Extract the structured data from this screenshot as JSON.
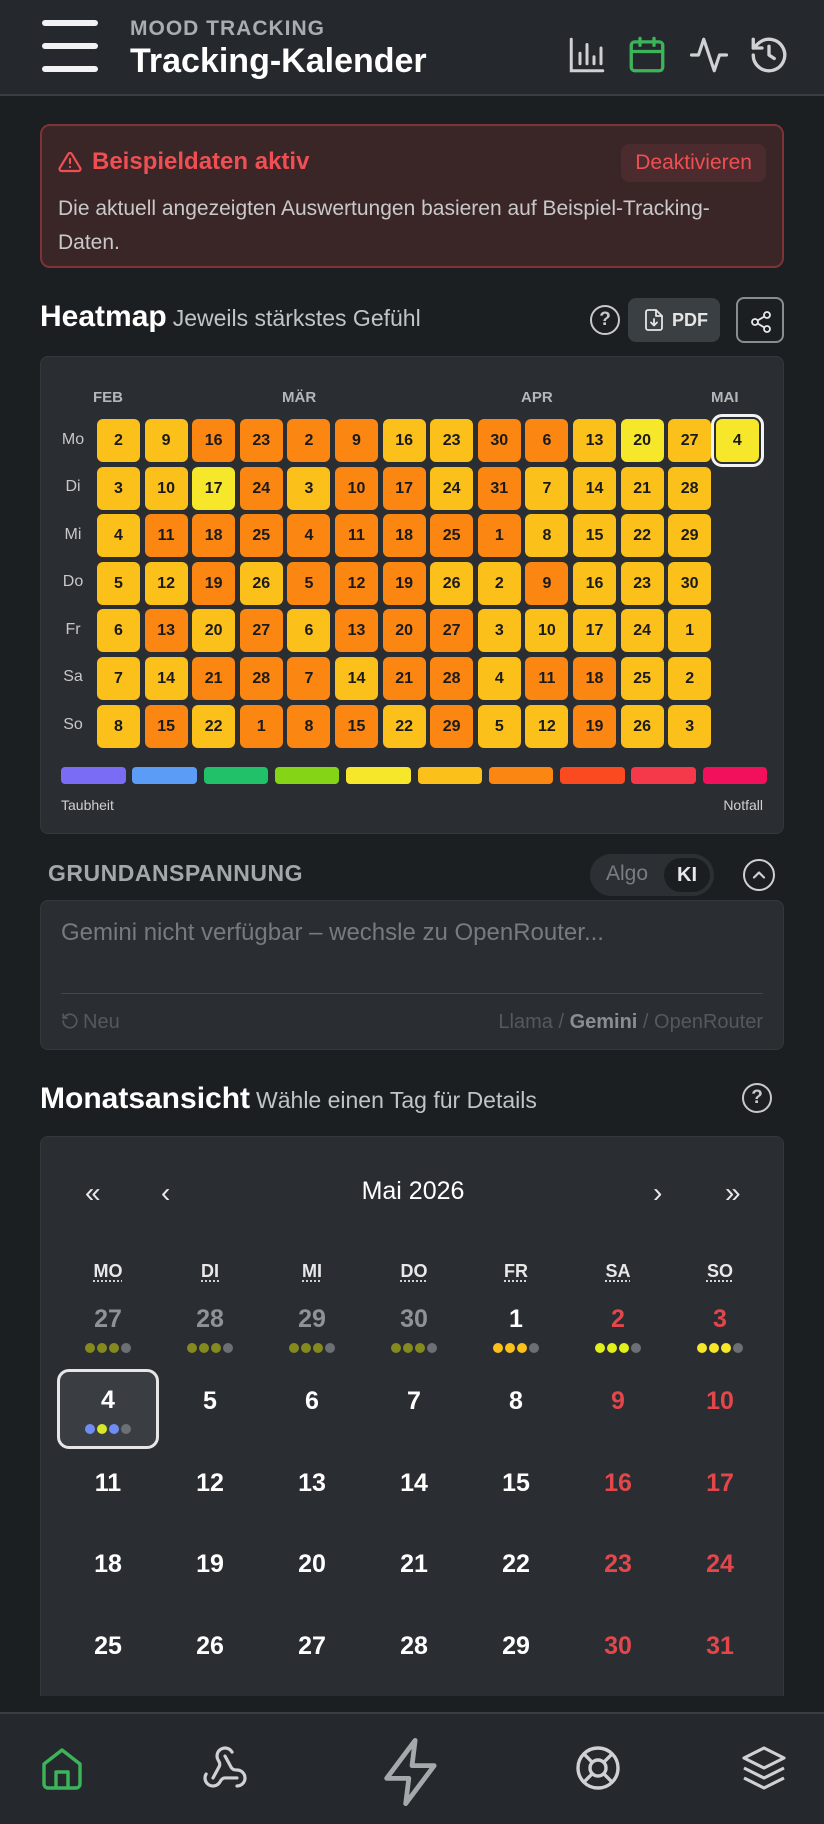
{
  "header": {
    "subtitle": "MOOD TRACKING",
    "title": "Tracking-Kalender",
    "icons": [
      "menu-icon",
      "bar-chart-icon",
      "calendar-icon",
      "activity-icon",
      "history-icon"
    ],
    "active_color": "#3cb55a"
  },
  "banner": {
    "title": "Beispieldaten aktiv",
    "button": "Deaktivieren",
    "text": "Die aktuell angezeigten Auswertungen basieren auf Beispiel-Tracking-Daten."
  },
  "heatmap": {
    "title": "Heatmap",
    "subtitle": "Jeweils stärkstes Gefühl",
    "help": "?",
    "pdf_label": "PDF",
    "months": [
      "FEB",
      "MÄR",
      "APR",
      "MAI"
    ],
    "days": [
      "Mo",
      "Di",
      "Mi",
      "Do",
      "Fr",
      "Sa",
      "So"
    ],
    "legend_left": "Taubheit",
    "legend_right": "Notfall",
    "legend_colors": [
      "#7b6cf6",
      "#5b9cf7",
      "#21c16a",
      "#86d416",
      "#f7e72a",
      "#fbc01a",
      "#fb8611",
      "#fb4a1f",
      "#f5384a",
      "#f20f5c"
    ],
    "columns": [
      [
        {
          "d": "2",
          "c": "#fbc01a"
        },
        {
          "d": "3",
          "c": "#fbc01a"
        },
        {
          "d": "4",
          "c": "#fbc01a"
        },
        {
          "d": "5",
          "c": "#fbc01a"
        },
        {
          "d": "6",
          "c": "#fbc01a"
        },
        {
          "d": "7",
          "c": "#fbc01a"
        },
        {
          "d": "8",
          "c": "#fbc01a"
        }
      ],
      [
        {
          "d": "9",
          "c": "#fbc01a"
        },
        {
          "d": "10",
          "c": "#fbc01a"
        },
        {
          "d": "11",
          "c": "#fb8611"
        },
        {
          "d": "12",
          "c": "#fbc01a"
        },
        {
          "d": "13",
          "c": "#fb8611"
        },
        {
          "d": "14",
          "c": "#fbc01a"
        },
        {
          "d": "15",
          "c": "#fb8611"
        }
      ],
      [
        {
          "d": "16",
          "c": "#fb8611"
        },
        {
          "d": "17",
          "c": "#f7e72a"
        },
        {
          "d": "18",
          "c": "#fb8611"
        },
        {
          "d": "19",
          "c": "#fb8611"
        },
        {
          "d": "20",
          "c": "#fbc01a"
        },
        {
          "d": "21",
          "c": "#fb8611"
        },
        {
          "d": "22",
          "c": "#fbc01a"
        }
      ],
      [
        {
          "d": "23",
          "c": "#fb8611"
        },
        {
          "d": "24",
          "c": "#fb8611"
        },
        {
          "d": "25",
          "c": "#fb8611"
        },
        {
          "d": "26",
          "c": "#fbc01a"
        },
        {
          "d": "27",
          "c": "#fb8611"
        },
        {
          "d": "28",
          "c": "#fb8611"
        },
        {
          "d": "1",
          "c": "#fb8611"
        }
      ],
      [
        {
          "d": "2",
          "c": "#fb8611"
        },
        {
          "d": "3",
          "c": "#fbc01a"
        },
        {
          "d": "4",
          "c": "#fb8611"
        },
        {
          "d": "5",
          "c": "#fb8611"
        },
        {
          "d": "6",
          "c": "#fbc01a"
        },
        {
          "d": "7",
          "c": "#fb8611"
        },
        {
          "d": "8",
          "c": "#fb8611"
        }
      ],
      [
        {
          "d": "9",
          "c": "#fb8611"
        },
        {
          "d": "10",
          "c": "#fb8611"
        },
        {
          "d": "11",
          "c": "#fb8611"
        },
        {
          "d": "12",
          "c": "#fb8611"
        },
        {
          "d": "13",
          "c": "#fb8611"
        },
        {
          "d": "14",
          "c": "#fbc01a"
        },
        {
          "d": "15",
          "c": "#fb8611"
        }
      ],
      [
        {
          "d": "16",
          "c": "#fbc01a"
        },
        {
          "d": "17",
          "c": "#fb8611"
        },
        {
          "d": "18",
          "c": "#fb8611"
        },
        {
          "d": "19",
          "c": "#fb8611"
        },
        {
          "d": "20",
          "c": "#fb8611"
        },
        {
          "d": "21",
          "c": "#fb8611"
        },
        {
          "d": "22",
          "c": "#fbc01a"
        }
      ],
      [
        {
          "d": "23",
          "c": "#fbc01a"
        },
        {
          "d": "24",
          "c": "#fbc01a"
        },
        {
          "d": "25",
          "c": "#fb8611"
        },
        {
          "d": "26",
          "c": "#fbc01a"
        },
        {
          "d": "27",
          "c": "#fb8611"
        },
        {
          "d": "28",
          "c": "#fb8611"
        },
        {
          "d": "29",
          "c": "#fb8611"
        }
      ],
      [
        {
          "d": "30",
          "c": "#fb8611"
        },
        {
          "d": "31",
          "c": "#fb8611"
        },
        {
          "d": "1",
          "c": "#fb8611"
        },
        {
          "d": "2",
          "c": "#fbc01a"
        },
        {
          "d": "3",
          "c": "#fbc01a"
        },
        {
          "d": "4",
          "c": "#fbc01a"
        },
        {
          "d": "5",
          "c": "#fbc01a"
        }
      ],
      [
        {
          "d": "6",
          "c": "#fb8611"
        },
        {
          "d": "7",
          "c": "#fbc01a"
        },
        {
          "d": "8",
          "c": "#fbc01a"
        },
        {
          "d": "9",
          "c": "#fb8611"
        },
        {
          "d": "10",
          "c": "#fbc01a"
        },
        {
          "d": "11",
          "c": "#fb8611"
        },
        {
          "d": "12",
          "c": "#fbc01a"
        }
      ],
      [
        {
          "d": "13",
          "c": "#fbc01a"
        },
        {
          "d": "14",
          "c": "#fbc01a"
        },
        {
          "d": "15",
          "c": "#fbc01a"
        },
        {
          "d": "16",
          "c": "#fbc01a"
        },
        {
          "d": "17",
          "c": "#fbc01a"
        },
        {
          "d": "18",
          "c": "#fb8611"
        },
        {
          "d": "19",
          "c": "#fb8611"
        }
      ],
      [
        {
          "d": "20",
          "c": "#f7e72a"
        },
        {
          "d": "21",
          "c": "#fbc01a"
        },
        {
          "d": "22",
          "c": "#fbc01a"
        },
        {
          "d": "23",
          "c": "#fbc01a"
        },
        {
          "d": "24",
          "c": "#fbc01a"
        },
        {
          "d": "25",
          "c": "#fbc01a"
        },
        {
          "d": "26",
          "c": "#fbc01a"
        }
      ],
      [
        {
          "d": "27",
          "c": "#fbc01a"
        },
        {
          "d": "28",
          "c": "#fbc01a"
        },
        {
          "d": "29",
          "c": "#fbc01a"
        },
        {
          "d": "30",
          "c": "#fbc01a"
        },
        {
          "d": "1",
          "c": "#fbc01a"
        },
        {
          "d": "2",
          "c": "#fbc01a"
        },
        {
          "d": "3",
          "c": "#fbc01a"
        }
      ],
      [
        {
          "d": "4",
          "c": "#f7e72a",
          "selected": true
        }
      ]
    ]
  },
  "grundanspannung": {
    "title": "GRUNDANSPANNUNG",
    "toggle_algo": "Algo",
    "toggle_ki": "KI",
    "text": "Gemini nicht verfügbar – wechsle zu OpenRouter...",
    "new_label": "Neu",
    "sources": [
      "Llama",
      "Gemini",
      "OpenRouter"
    ],
    "active_source": "Gemini"
  },
  "month_view": {
    "title": "Monatsansicht",
    "subtitle": "Wähle einen Tag für Details",
    "month_label": "Mai 2026",
    "nav": {
      "first": "«",
      "prev": "‹",
      "next": "›",
      "last": "»"
    },
    "weekdays": [
      "MO",
      "DI",
      "MI",
      "DO",
      "FR",
      "SA",
      "SO"
    ],
    "weeks": [
      [
        {
          "d": "27",
          "other": true,
          "dots": [
            "#858a1f",
            "#858a1f",
            "#858a1f",
            "#6c6f73"
          ]
        },
        {
          "d": "28",
          "other": true,
          "dots": [
            "#858a1f",
            "#858a1f",
            "#858a1f",
            "#6c6f73"
          ]
        },
        {
          "d": "29",
          "other": true,
          "dots": [
            "#858a1f",
            "#858a1f",
            "#858a1f",
            "#6c6f73"
          ]
        },
        {
          "d": "30",
          "other": true,
          "dots": [
            "#858a1f",
            "#858a1f",
            "#858a1f",
            "#6c6f73"
          ]
        },
        {
          "d": "1",
          "dots": [
            "#fbc01a",
            "#fbc01a",
            "#fbc01a",
            "#6c6f73"
          ]
        },
        {
          "d": "2",
          "we": true,
          "dots": [
            "#e0f01a",
            "#e0f01a",
            "#e0f01a",
            "#6c6f73"
          ]
        },
        {
          "d": "3",
          "we": true,
          "dots": [
            "#f7e72a",
            "#f7e72a",
            "#f7e72a",
            "#6c6f73"
          ]
        }
      ],
      [
        {
          "d": "4",
          "today": true,
          "dots": [
            "#6f8df5",
            "#d7e82a",
            "#6f8df5",
            "#6c6f73"
          ]
        },
        {
          "d": "5"
        },
        {
          "d": "6"
        },
        {
          "d": "7"
        },
        {
          "d": "8"
        },
        {
          "d": "9",
          "we": true
        },
        {
          "d": "10",
          "we": true
        }
      ],
      [
        {
          "d": "11"
        },
        {
          "d": "12"
        },
        {
          "d": "13"
        },
        {
          "d": "14"
        },
        {
          "d": "15"
        },
        {
          "d": "16",
          "we": true
        },
        {
          "d": "17",
          "we": true
        }
      ],
      [
        {
          "d": "18"
        },
        {
          "d": "19"
        },
        {
          "d": "20"
        },
        {
          "d": "21"
        },
        {
          "d": "22"
        },
        {
          "d": "23",
          "we": true
        },
        {
          "d": "24",
          "we": true
        }
      ],
      [
        {
          "d": "25"
        },
        {
          "d": "26"
        },
        {
          "d": "27"
        },
        {
          "d": "28"
        },
        {
          "d": "29"
        },
        {
          "d": "30",
          "we": true
        },
        {
          "d": "31",
          "we": true
        }
      ]
    ]
  },
  "bottom_nav": {
    "icons": [
      "home-icon",
      "webhook-icon",
      "lightning-icon",
      "lifebuoy-icon",
      "layers-icon"
    ]
  }
}
